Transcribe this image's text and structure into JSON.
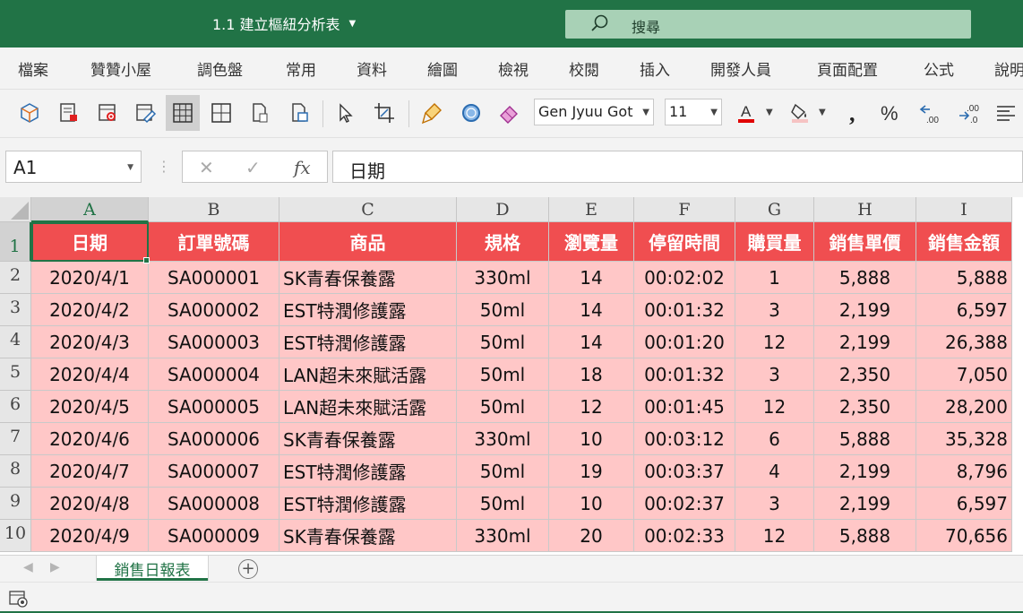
{
  "title_bar": {
    "doc_title": "1.1 建立樞紐分析表",
    "search_label": "搜尋"
  },
  "menu": [
    "檔案",
    "贊贊小屋",
    "調色盤",
    "常用",
    "資料",
    "繪圖",
    "檢視",
    "校閱",
    "插入",
    "開發人員",
    "頁面配置",
    "公式",
    "說明"
  ],
  "toolbar": {
    "font_name": "Gen Jyuu Got",
    "font_size": "11",
    "font_color": "#e00000",
    "fill_color": "#f6c3c3"
  },
  "formula_bar": {
    "name_box": "A1",
    "formula": "日期",
    "fx_label": "fx"
  },
  "columns": [
    "A",
    "B",
    "C",
    "D",
    "E",
    "F",
    "G",
    "H",
    "I"
  ],
  "rows": [
    "1",
    "2",
    "3",
    "4",
    "5",
    "6",
    "7",
    "8",
    "9",
    "10"
  ],
  "header_row": [
    "日期",
    "訂單號碼",
    "商品",
    "規格",
    "瀏覽量",
    "停留時間",
    "購買量",
    "銷售單價",
    "銷售金額"
  ],
  "data_rows": [
    [
      "2020/4/1",
      "SA000001",
      "SK青春保養露",
      "330ml",
      "14",
      "00:02:02",
      "1",
      "5,888",
      "5,888"
    ],
    [
      "2020/4/2",
      "SA000002",
      "EST特潤修護露",
      "50ml",
      "14",
      "00:01:32",
      "3",
      "2,199",
      "6,597"
    ],
    [
      "2020/4/3",
      "SA000003",
      "EST特潤修護露",
      "50ml",
      "14",
      "00:01:20",
      "12",
      "2,199",
      "26,388"
    ],
    [
      "2020/4/4",
      "SA000004",
      "LAN超未來賦活露",
      "50ml",
      "18",
      "00:01:32",
      "3",
      "2,350",
      "7,050"
    ],
    [
      "2020/4/5",
      "SA000005",
      "LAN超未來賦活露",
      "50ml",
      "12",
      "00:01:45",
      "12",
      "2,350",
      "28,200"
    ],
    [
      "2020/4/6",
      "SA000006",
      "SK青春保養露",
      "330ml",
      "10",
      "00:03:12",
      "6",
      "5,888",
      "35,328"
    ],
    [
      "2020/4/7",
      "SA000007",
      "EST特潤修護露",
      "50ml",
      "19",
      "00:03:37",
      "4",
      "2,199",
      "8,796"
    ],
    [
      "2020/4/8",
      "SA000008",
      "EST特潤修護露",
      "50ml",
      "10",
      "00:02:37",
      "3",
      "2,199",
      "6,597"
    ],
    [
      "2020/4/9",
      "SA000009",
      "SK青春保養露",
      "330ml",
      "20",
      "00:02:33",
      "12",
      "5,888",
      "70,656"
    ]
  ],
  "sheet_tab": "銷售日報表",
  "colors": {
    "accent": "#217346",
    "header_fill": "#f04e50",
    "body_fill": "#ffc7c7"
  }
}
